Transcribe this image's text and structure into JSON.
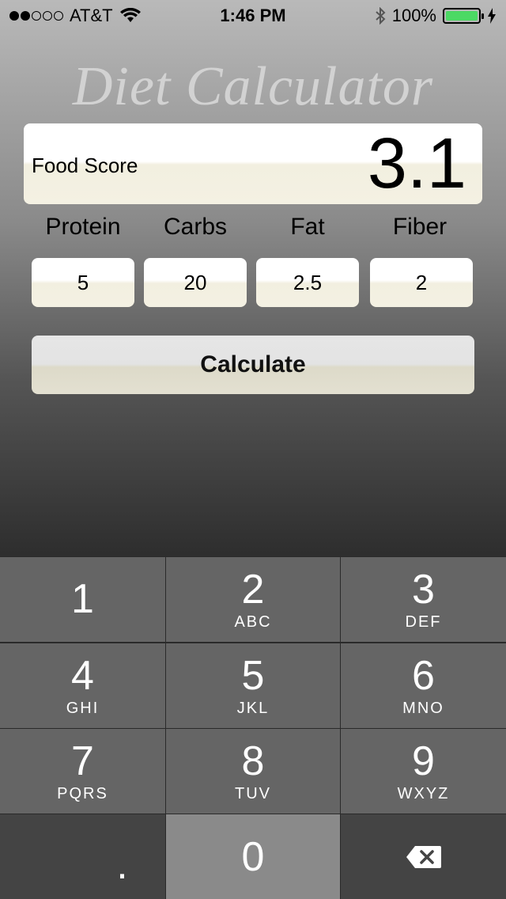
{
  "status_bar": {
    "carrier": "AT&T",
    "time": "1:46 PM",
    "battery": "100%"
  },
  "app": {
    "title": "Diet Calculator"
  },
  "score": {
    "label": "Food Score",
    "value": "3.1"
  },
  "nutrients": [
    {
      "label": "Protein",
      "value": "5"
    },
    {
      "label": "Carbs",
      "value": "20"
    },
    {
      "label": "Fat",
      "value": "2.5"
    },
    {
      "label": "Fiber",
      "value": "2"
    }
  ],
  "calculate_button": {
    "label": "Calculate"
  },
  "keypad": {
    "keys": [
      {
        "digit": "1",
        "letters": ""
      },
      {
        "digit": "2",
        "letters": "ABC"
      },
      {
        "digit": "3",
        "letters": "DEF"
      },
      {
        "digit": "4",
        "letters": "GHI"
      },
      {
        "digit": "5",
        "letters": "JKL"
      },
      {
        "digit": "6",
        "letters": "MNO"
      },
      {
        "digit": "7",
        "letters": "PQRS"
      },
      {
        "digit": "8",
        "letters": "TUV"
      },
      {
        "digit": "9",
        "letters": "WXYZ"
      },
      {
        "digit": ".",
        "letters": ""
      },
      {
        "digit": "0",
        "letters": ""
      }
    ],
    "backspace_icon": "backspace-icon"
  },
  "colors": {
    "battery": "#4cd964",
    "key": "#656565",
    "key_dark": "#444444",
    "key_active": "#8a8a8a",
    "title": "#d2d2d2"
  }
}
